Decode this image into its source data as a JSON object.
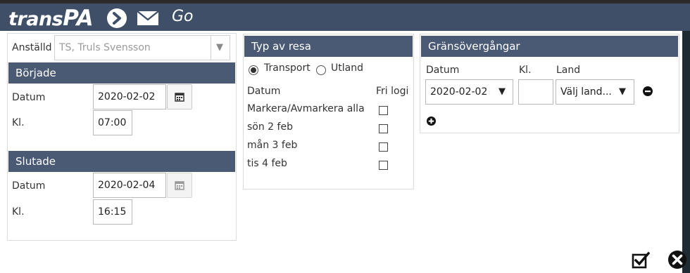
{
  "app": {
    "logo_trans": "trans",
    "logo_pa": "PA",
    "go_label": "Go"
  },
  "employee": {
    "label": "Anställd",
    "value": "TS, Truls Svensson",
    "caret": "▼"
  },
  "started": {
    "title": "Började",
    "date_label": "Datum",
    "date_value": "2020-02-02",
    "time_label": "Kl.",
    "time_value": "07:00"
  },
  "ended": {
    "title": "Slutade",
    "date_label": "Datum",
    "date_value": "2020-02-04",
    "time_label": "Kl.",
    "time_value": "16:15"
  },
  "trip_type": {
    "title": "Typ av resa",
    "options": [
      "Transport",
      "Utland"
    ],
    "selected": "Transport",
    "col_date": "Datum",
    "col_free": "Fri logi",
    "rows": [
      "Markera/Avmarkera alla",
      "sön 2 feb",
      "mån 3 feb",
      "tis 4 feb"
    ]
  },
  "border": {
    "title": "Gränsövergångar",
    "col_date": "Datum",
    "col_time": "Kl.",
    "col_country": "Land",
    "date_value": "2020-02-02",
    "time_value": "",
    "country_value": "Välj land...",
    "caret": "▼"
  }
}
